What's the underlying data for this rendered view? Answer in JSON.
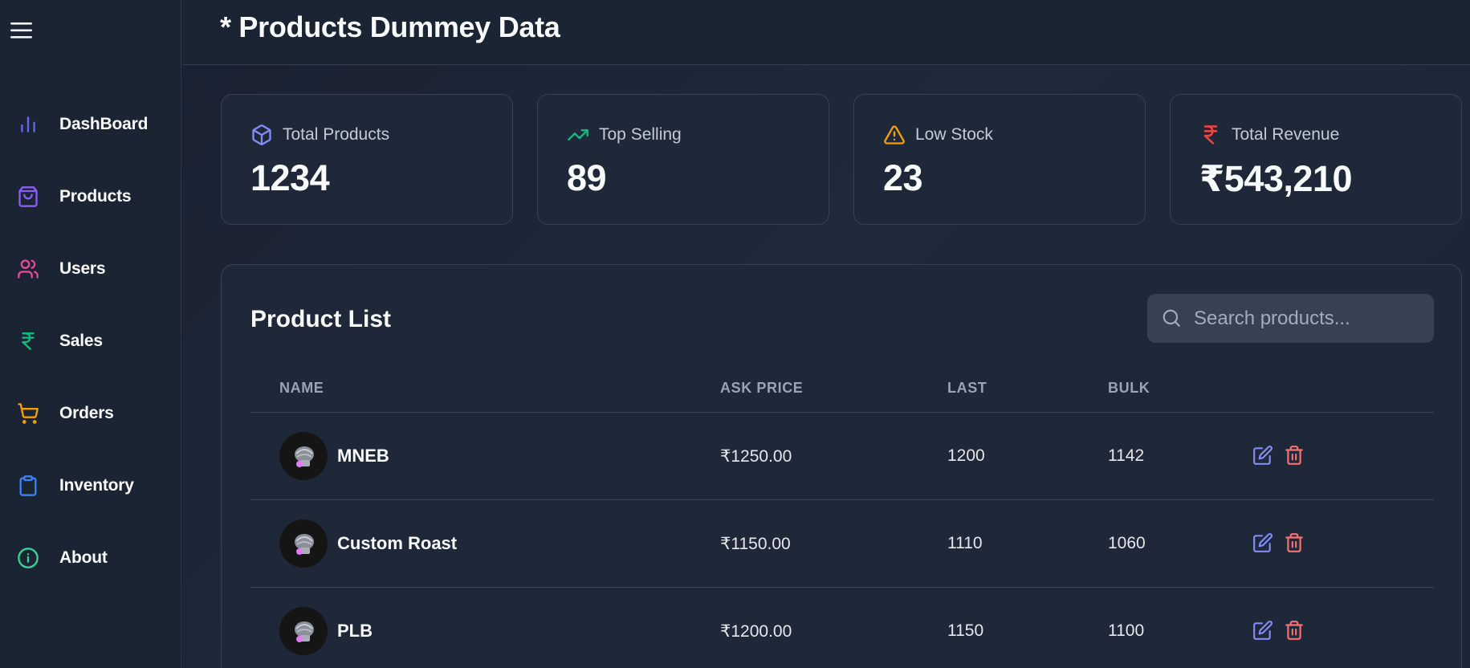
{
  "header": {
    "title": "* Products Dummey Data"
  },
  "sidebar": {
    "items": [
      {
        "label": "DashBoard",
        "icon": "bar-chart-icon",
        "color": "#6366f1"
      },
      {
        "label": "Products",
        "icon": "shopping-bag-icon",
        "color": "#8b5cf6"
      },
      {
        "label": "Users",
        "icon": "users-icon",
        "color": "#ec4899"
      },
      {
        "label": "Sales",
        "icon": "rupee-icon",
        "color": "#10b981"
      },
      {
        "label": "Orders",
        "icon": "shopping-cart-icon",
        "color": "#f59e0b"
      },
      {
        "label": "Inventory",
        "icon": "clipboard-icon",
        "color": "#3b82f6"
      },
      {
        "label": "About",
        "icon": "info-icon",
        "color": "#34d399"
      }
    ]
  },
  "stats": [
    {
      "label": "Total Products",
      "value": "1234",
      "icon": "package-icon",
      "color": "#818cf8"
    },
    {
      "label": "Top Selling",
      "value": "89",
      "icon": "trending-up-icon",
      "color": "#10b981"
    },
    {
      "label": "Low Stock",
      "value": "23",
      "icon": "alert-triangle-icon",
      "color": "#f59e0b"
    },
    {
      "label": "Total Revenue",
      "value": "₹543,210",
      "icon": "rupee-icon",
      "color": "#ef4444"
    }
  ],
  "product_list": {
    "title": "Product List",
    "search_placeholder": "Search products...",
    "columns": [
      "NAME",
      "ASK PRICE",
      "LAST",
      "BULK"
    ],
    "rows": [
      {
        "name": "MNEB",
        "ask_price": "₹1250.00",
        "last": "1200",
        "bulk": "1142"
      },
      {
        "name": "Custom Roast",
        "ask_price": "₹1150.00",
        "last": "1110",
        "bulk": "1060"
      },
      {
        "name": "PLB",
        "ask_price": "₹1200.00",
        "last": "1150",
        "bulk": "1100"
      }
    ]
  },
  "colors": {
    "edit": "#818cf8",
    "delete": "#f87171"
  }
}
